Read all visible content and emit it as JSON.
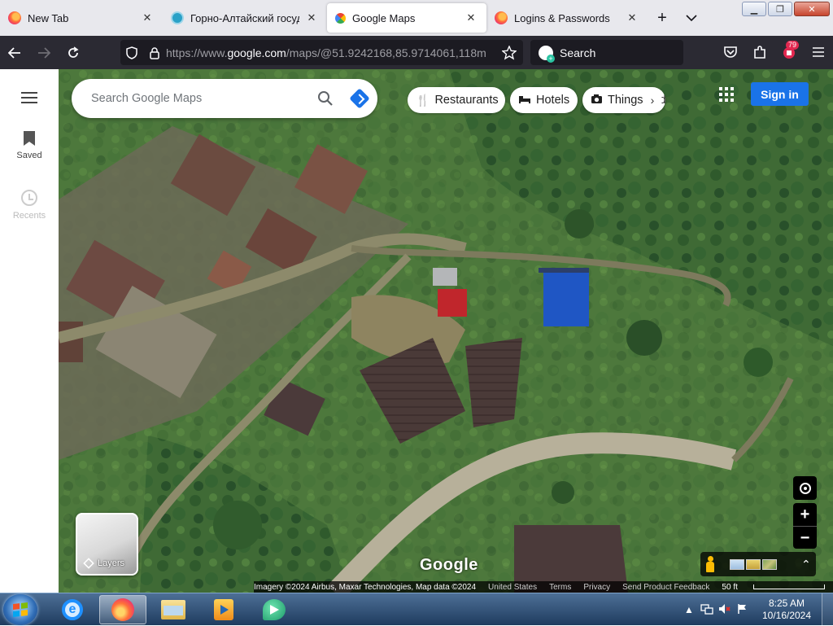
{
  "browser": {
    "tabs": [
      {
        "title": "New Tab",
        "favicon": "firefox-icon"
      },
      {
        "title": "Горно-Алтайский государ",
        "favicon": "university-icon"
      },
      {
        "title": "Google Maps",
        "favicon": "google-maps-icon",
        "active": true
      },
      {
        "title": "Logins & Passwords",
        "favicon": "firefox-icon"
      }
    ],
    "url_prefix": "https://www.",
    "url_host": "google.com",
    "url_path": "/maps/@51.9242168,85.9714061,118m",
    "search_placeholder": "Search",
    "extensions_badge": "79"
  },
  "maps": {
    "menu_label": "Menu",
    "saved_label": "Saved",
    "recents_label": "Recents",
    "search_placeholder": "Search Google Maps",
    "chips": {
      "restaurants": "Restaurants",
      "hotels": "Hotels",
      "things": "Things to do"
    },
    "signin_label": "Sign in",
    "layers_label": "Layers",
    "zoom_in": "+",
    "zoom_out": "−",
    "logo": "Google",
    "attribution": {
      "imagery": "Imagery ©2024 Airbus, Maxar Technologies, Map data ©2024",
      "country": "United States",
      "terms": "Terms",
      "privacy": "Privacy",
      "feedback": "Send Product Feedback",
      "scale": "50 ft"
    }
  },
  "taskbar": {
    "time": "8:25 AM",
    "date": "10/16/2024",
    "tray_arrow": "▲"
  },
  "colors": {
    "accent": "#1a73e8",
    "toolbar": "#2b2a33",
    "tabstrip": "#e8e8ed"
  }
}
